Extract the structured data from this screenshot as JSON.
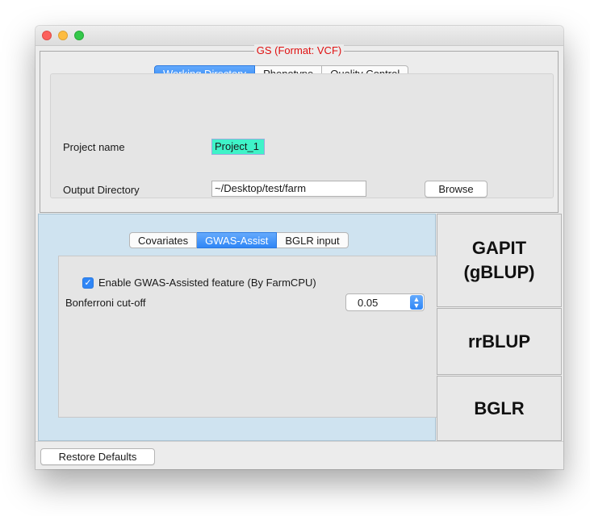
{
  "window": {
    "title": "",
    "controls": [
      "close-icon",
      "minimize-icon",
      "maximize-icon"
    ]
  },
  "gs_group": {
    "title": "GS (Format: VCF)",
    "title_color": "#e01010",
    "tabs": [
      {
        "label": "Working Directory",
        "active": true
      },
      {
        "label": "Phenotype",
        "active": false
      },
      {
        "label": "Quality Control",
        "active": false
      }
    ],
    "project_name_label": "Project name",
    "project_name_value": "Project_1",
    "output_dir_label": "Output Directory",
    "output_dir_value": "~/Desktop/test/farm",
    "browse_label": "Browse"
  },
  "model_panel": {
    "tabs": [
      {
        "label": "Covariates",
        "active": false
      },
      {
        "label": "GWAS-Assist",
        "active": true
      },
      {
        "label": "BGLR input",
        "active": false
      }
    ],
    "enable_gwas_label": "Enable GWAS-Assisted feature (By FarmCPU)",
    "enable_gwas_checked": true,
    "bonferroni_label": "Bonferroni cut-off",
    "bonferroni_value": "0.05"
  },
  "run_buttons": {
    "gapit": "GAPIT\n(gBLUP)",
    "rrblup": "rrBLUP",
    "bglr": "BGLR"
  },
  "footer": {
    "restore_label": "Restore Defaults"
  },
  "colors": {
    "accent": "#2f86f6",
    "project_field_bg": "#3ff3c8",
    "left_panel_bg": "#cfe3f0"
  }
}
